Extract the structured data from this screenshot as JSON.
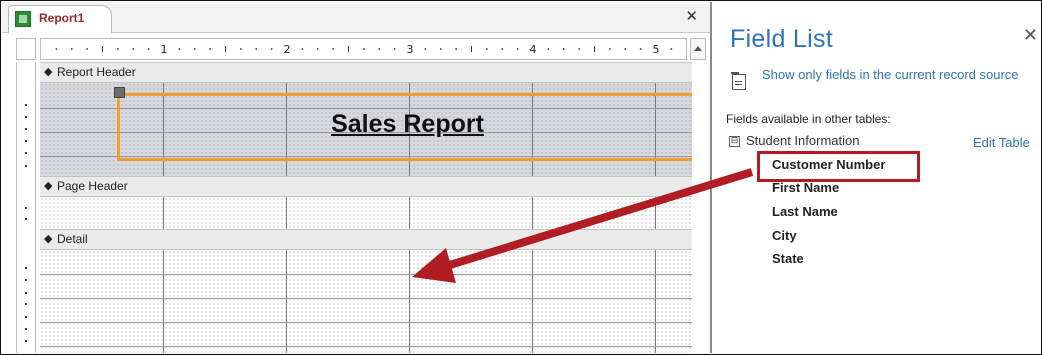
{
  "document_tab": {
    "title": "Report1",
    "close_glyph": "✕"
  },
  "ruler": {
    "numbers": [
      "1",
      "2",
      "3",
      "4",
      "5"
    ]
  },
  "sections": {
    "report_header": {
      "label": "Report Header"
    },
    "page_header": {
      "label": "Page Header"
    },
    "detail": {
      "label": "Detail"
    }
  },
  "title_control": {
    "text": "Sales Report"
  },
  "field_list": {
    "title": "Field List",
    "close_glyph": "✕",
    "show_only_link": "Show only fields in the current record source",
    "available_label": "Fields available in other tables:",
    "table": {
      "expander": "⊟",
      "name": "Student Information",
      "edit_link": "Edit Table"
    },
    "fields": [
      "Customer Number",
      "First Name",
      "Last Name",
      "City",
      "State"
    ]
  },
  "colors": {
    "highlight_box": "#b01d22",
    "arrow": "#b01d22",
    "title_border": "#f0a030",
    "link_blue": "#2e73b9"
  },
  "icons": {
    "tab_icon": "report-icon",
    "section_arrow": "section-collapse-icon",
    "show_only": "filter-doc-icon"
  }
}
